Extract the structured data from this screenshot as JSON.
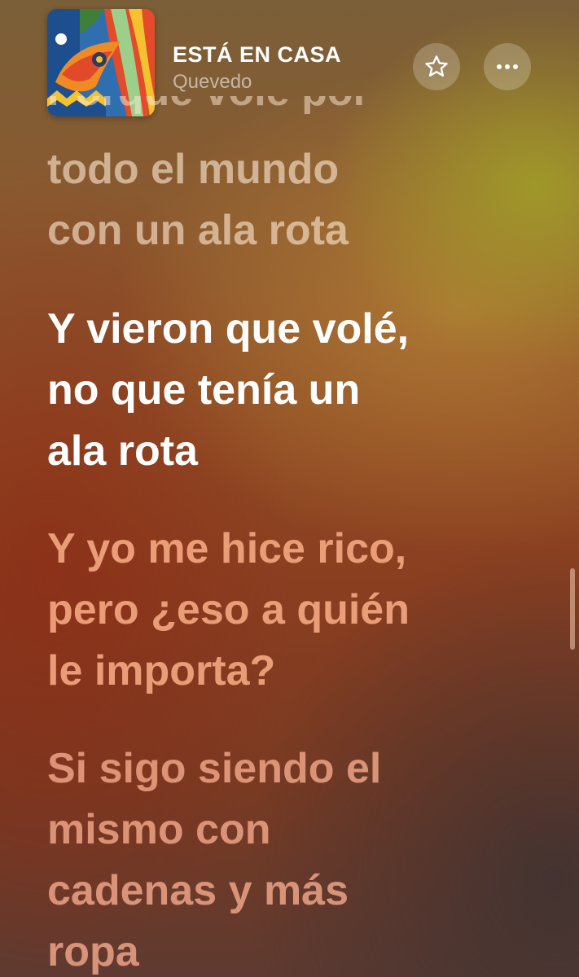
{
  "track": {
    "title": "ESTÁ EN CASA",
    "artist": "Quevedo"
  },
  "icons": {
    "favorite": "star-icon",
    "more": "ellipsis-icon"
  },
  "lyrics": {
    "previous_cut": "Porque volé por",
    "previous": [
      "todo el mundo",
      "con un ala rota"
    ],
    "current": [
      "Y vieron que volé,",
      "no que tenía un",
      "ala rota"
    ],
    "next": [
      "Y yo me hice rico,",
      "pero ¿eso a quién",
      "le importa?"
    ],
    "after": [
      "Si sigo siendo el",
      "mismo con",
      "cadenas y más",
      "ropa"
    ]
  },
  "colors": {
    "active_text": "#ffffff",
    "upcoming_text": "#f5b08a"
  }
}
